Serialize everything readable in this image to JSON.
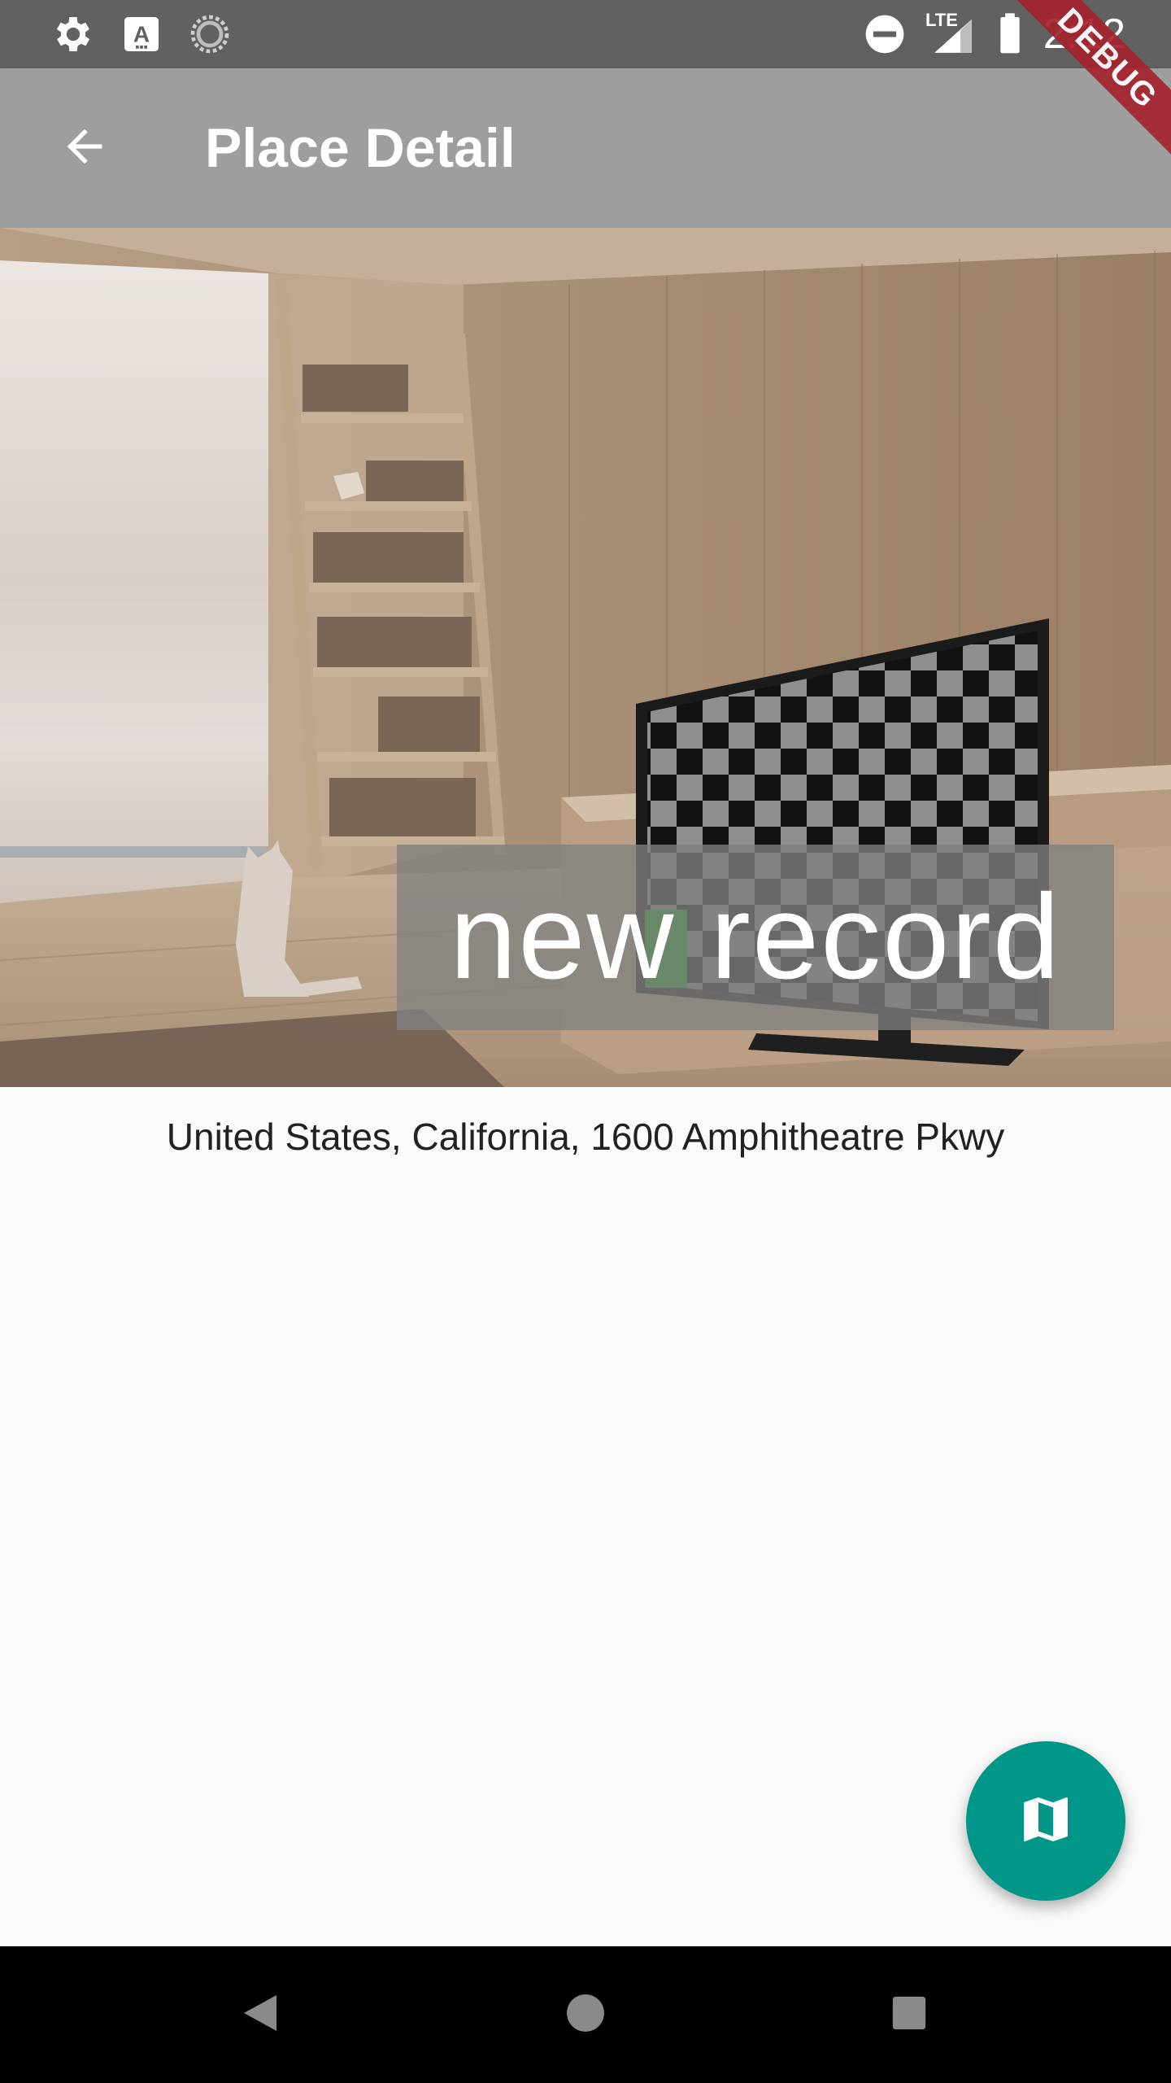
{
  "status_bar": {
    "time": "2:12",
    "network_label": "LTE",
    "icons": [
      "settings-icon",
      "text-a-icon",
      "sync-icon",
      "do-not-disturb-icon",
      "signal-icon",
      "battery-icon"
    ]
  },
  "app_bar": {
    "title": "Place Detail",
    "back_icon": "arrow-back-icon",
    "debug_banner": "DEBUG"
  },
  "place": {
    "title": "new record",
    "address": "United States, California, 1600 Amphitheatre Pkwy"
  },
  "fab": {
    "icon": "map-icon",
    "color": "#009688"
  },
  "nav_bar": {
    "icons": [
      "back-triangle-icon",
      "home-circle-icon",
      "recents-square-icon"
    ]
  },
  "colors": {
    "status_bar": "#616161",
    "app_bar": "#9e9e9e",
    "background": "#fafafa",
    "debug_banner": "#a4232f"
  }
}
